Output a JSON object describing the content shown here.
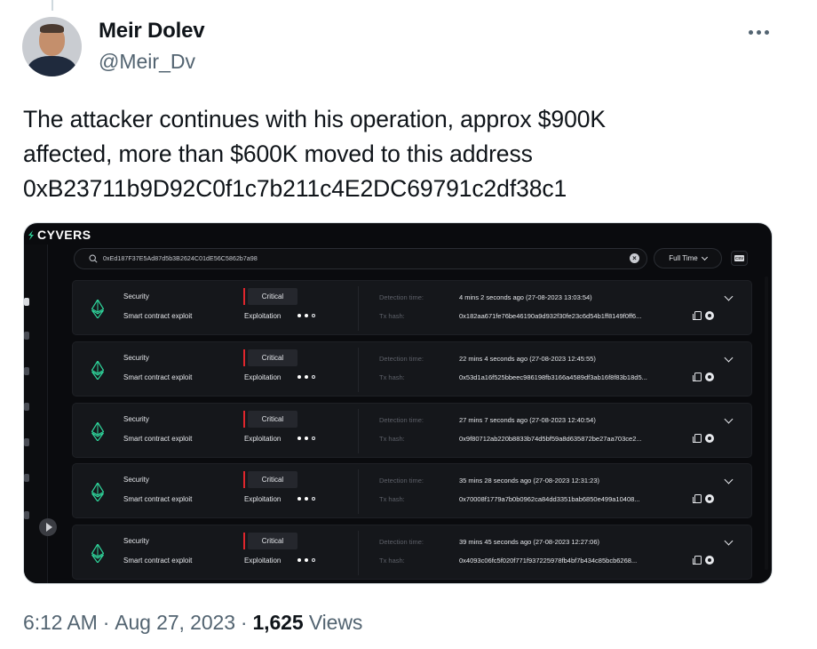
{
  "tweet": {
    "author_name": "Meir Dolev",
    "author_handle": "@Meir_Dv",
    "text_lines": [
      "The attacker continues with his operation, approx $900K",
      "affected, more than $600K moved to this address",
      "0xB23711b9D92C0f1c7b211c4E2DC69791c2df38c1"
    ],
    "time": "6:12 AM",
    "date": "Aug 27, 2023",
    "views_count": "1,625",
    "views_label": "Views",
    "separator": "·"
  },
  "app": {
    "brand": "CYVERS",
    "search_value": "0xEd187F37E5Ad87d5b3B2624C01dE56C5862b7a98",
    "time_filter": "Full Time",
    "csv_label": "CSV",
    "detection_time_label": "Detection time:",
    "tx_hash_label": "Tx hash:",
    "alerts": [
      {
        "category": "Security",
        "type": "Smart contract exploit",
        "severity": "Critical",
        "phase": "Exploitation",
        "detection_time": "4 mins 2 seconds ago (27-08-2023 13:03:54)",
        "tx_hash": "0x182aa671fe76be46190a9d932f30fe23c6d54b1ff8149f0ff6..."
      },
      {
        "category": "Security",
        "type": "Smart contract exploit",
        "severity": "Critical",
        "phase": "Exploitation",
        "detection_time": "22 mins 4 seconds ago (27-08-2023 12:45:55)",
        "tx_hash": "0x53d1a16f525bbeec986198fb3166a4589df3ab16f8f83b18d5..."
      },
      {
        "category": "Security",
        "type": "Smart contract exploit",
        "severity": "Critical",
        "phase": "Exploitation",
        "detection_time": "27 mins 7 seconds ago (27-08-2023 12:40:54)",
        "tx_hash": "0x9f80712ab220b8833b74d5bf59a8d635872be27aa703ce2..."
      },
      {
        "category": "Security",
        "type": "Smart contract exploit",
        "severity": "Critical",
        "phase": "Exploitation",
        "detection_time": "35 mins 28 seconds ago (27-08-2023 12:31:23)",
        "tx_hash": "0x70008f1779a7b0b0962ca84dd3351bab6850e499a10408..."
      },
      {
        "category": "Security",
        "type": "Smart contract exploit",
        "severity": "Critical",
        "phase": "Exploitation",
        "detection_time": "39 mins 45 seconds ago (27-08-2023 12:27:06)",
        "tx_hash": "0x4093c06fc5f020f771f937225978fb4bf7b434c85bcb6268..."
      }
    ]
  },
  "colors": {
    "brand_accent": "#2fd39a",
    "critical": "#e0262d",
    "muted_text": "#536471"
  },
  "icons": {
    "more": "more-horizontal-icon",
    "search": "search-icon",
    "asset": "ethereum-icon",
    "copy": "copy-icon",
    "explorer": "explorer-icon",
    "expand": "chevron-down-icon"
  }
}
